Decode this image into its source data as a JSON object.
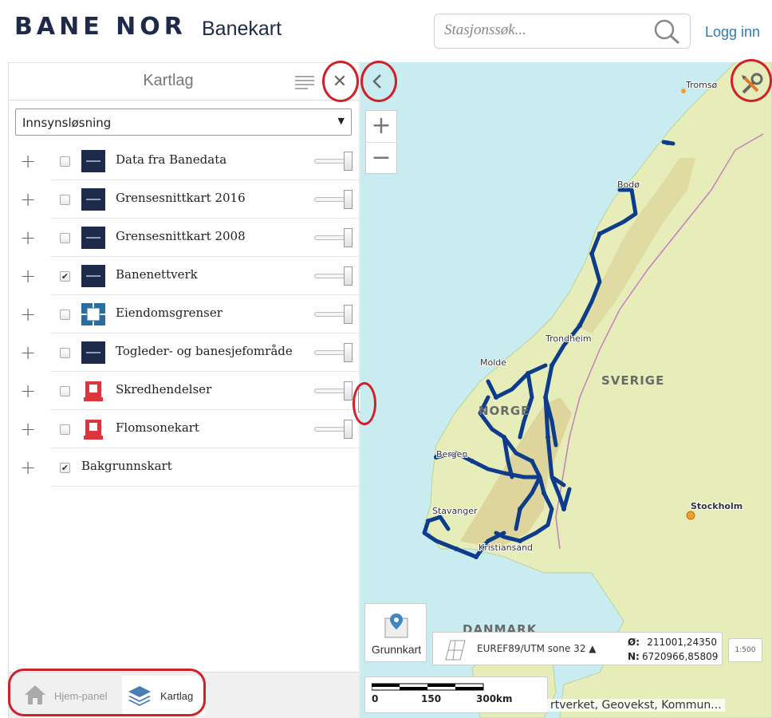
{
  "header": {
    "logo_text": "BANE NOR",
    "app_title": "Banekart",
    "search_placeholder": "Stasjonssøk...",
    "login_label": "Logg inn"
  },
  "panel": {
    "title": "Kartlag",
    "dropdown_value": "Innsynsløsning",
    "layers": [
      {
        "name": "Data fra Banedata",
        "checked": false,
        "icon": "bane-nor-logo-icon"
      },
      {
        "name": "Grensesnittkart 2016",
        "checked": false,
        "icon": "bane-nor-logo-icon"
      },
      {
        "name": "Grensesnittkart 2008",
        "checked": false,
        "icon": "bane-nor-logo-icon"
      },
      {
        "name": "Banenettverk",
        "checked": true,
        "icon": "bane-nor-logo-icon"
      },
      {
        "name": "Eiendomsgrenser",
        "checked": false,
        "icon": "property-boundary-icon"
      },
      {
        "name": "Togleder- og banesjefområde",
        "checked": false,
        "icon": "bane-nor-logo-icon"
      },
      {
        "name": "Skredhendelser",
        "checked": false,
        "icon": "nve-logo-icon"
      },
      {
        "name": "Flomsonekart",
        "checked": false,
        "icon": "nve-logo-icon"
      },
      {
        "name": "Bakgrunnskart",
        "checked": true,
        "icon": ""
      }
    ],
    "tabs": {
      "home": "Hjem-panel",
      "layers": "Kartlag"
    }
  },
  "map": {
    "basemap_label": "Grunnkart",
    "projection": "EUREF89/UTM sone 32 ▲",
    "coord_o_label": "Ø:",
    "coord_o_value": "211001,24350",
    "coord_n_label": "N:",
    "coord_n_value": "6720966,85809",
    "scale_button": "1:500",
    "scale_labels": [
      "0",
      "150",
      "300km"
    ],
    "attribution": "rtverket, Geovekst, Kommun...",
    "places": {
      "tromso": "Tromsø",
      "bodo": "Bodø",
      "trondheim": "Trondheim",
      "molde": "Molde",
      "bergen": "Bergen",
      "stavanger": "Stavanger",
      "kristiansand": "Kristiansand",
      "stockholm": "Stockholm",
      "norge": "NORGE",
      "sverige": "SVERIGE",
      "danmark": "DANMARK"
    },
    "colors": {
      "sea": "#c9ecf0",
      "land": "#e6edb8",
      "network": "#0d3c8c",
      "annotation": "#d0202a"
    }
  }
}
